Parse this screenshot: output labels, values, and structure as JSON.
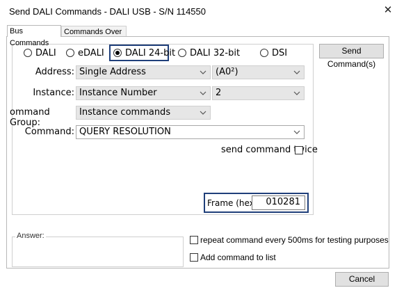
{
  "window": {
    "title": "Send DALI Commands - DALI USB - S/N 114550",
    "close_label": "✕"
  },
  "tabs": [
    {
      "label": "Bus Commands",
      "active": true
    },
    {
      "label": "Commands Over Time",
      "active": false
    }
  ],
  "protocols": [
    {
      "label": "DALI",
      "selected": false
    },
    {
      "label": "eDALI",
      "selected": false
    },
    {
      "label": "DALI 24-bit",
      "selected": true
    },
    {
      "label": "DALI 32-bit",
      "selected": false
    },
    {
      "label": "DSI",
      "selected": false
    }
  ],
  "fields": {
    "address": {
      "label": "Address:",
      "value": "Single Address",
      "sub_value": "(A0²)"
    },
    "instance": {
      "label": "Instance:",
      "value": "Instance Number",
      "sub_value": "2"
    },
    "command_group": {
      "label": "ommand Group:",
      "value": "Instance commands"
    },
    "command": {
      "label": "Command:",
      "value": "QUERY RESOLUTION"
    }
  },
  "send_twice_label": "send command twice",
  "frame": {
    "label": "Frame (hex):",
    "value": "010281"
  },
  "send_button_label": "Send Command(s)",
  "answer_label": "Answer:",
  "repeat_label": "repeat command every 500ms for testing purposes",
  "add_to_list_label": "Add command to list",
  "cancel_label": "Cancel",
  "colors": {
    "highlight": "#1f3f7a",
    "combo_bg": "#e6e6e6"
  }
}
